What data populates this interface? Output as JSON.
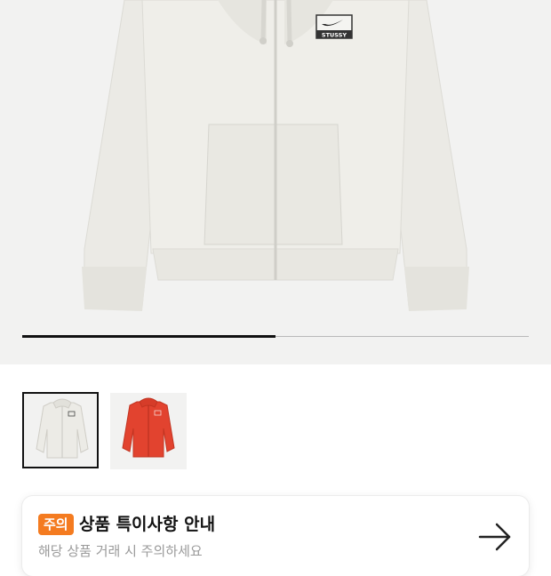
{
  "gallery": {
    "product_image": "cream-zip-hoodie",
    "logo_text": "STUSSY",
    "image_position": 0.5,
    "thumbnails": [
      {
        "label": "cream-zip-hoodie",
        "color": "#ecebe6",
        "selected": true
      },
      {
        "label": "red-zip-hoodie",
        "color": "#e2432f",
        "selected": false
      }
    ]
  },
  "notice": {
    "badge": "주의",
    "title": "상품 특이사항 안내",
    "subtitle": "해당 상품 거래 시 주의하세요",
    "arrow_icon": "arrow-right-icon"
  },
  "colors": {
    "badge_orange": "#f47b20",
    "hoodie_cream": "#ecebe6",
    "hoodie_red": "#e2432f"
  }
}
